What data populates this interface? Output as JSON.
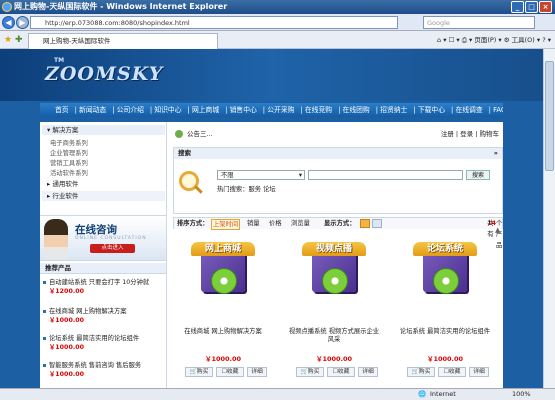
{
  "window": {
    "title": "网上购物-天纵国际软件 - Windows Internet Explorer",
    "min": "_",
    "max": "□",
    "close": "×"
  },
  "addressbar": {
    "url": "http://erp.073088.com:8080/shopindex.html",
    "search_placeholder": "Google",
    "back": "◀",
    "forward": "▶"
  },
  "tab": {
    "label": "网上购物-天纵国际软件",
    "toolbar_text": "⌂ ▾ ☐ ▾ ⎙ ▾  页面(P) ▾  ⚙ 工具(O) ▾  ? ▾"
  },
  "status": {
    "zone": "Internet",
    "zoom": "100%"
  },
  "site": {
    "logo_tm": "TM",
    "logo": "ZOOMSKY",
    "nav": [
      "首页",
      "新闻动态",
      "公司介绍",
      "知识中心",
      "网上商城",
      "销售中心",
      "公开采购",
      "在线竞购",
      "在线团购",
      "招贤纳士",
      "下载中心",
      "在线调查",
      "FAQ",
      "论坛"
    ]
  },
  "left": {
    "cat1": "解决方案",
    "subs": [
      "电子商务系列",
      "企业管理系列",
      "营销工具系列",
      "活动软件系列"
    ],
    "cat2": "通用软件",
    "cat3": "行业软件",
    "consult_title": "在线咨询",
    "consult_en": "ONLINE CONSULTATION",
    "consult_btn": "点击进入",
    "rec_title": "推荐产品",
    "rec": [
      {
        "name": "自动建站系统 只要会打字 10分钟就",
        "price": "￥1200.00"
      },
      {
        "name": "在线商城 网上购物解决方案",
        "price": "￥1000.00"
      },
      {
        "name": "论坛系统 最简洁实用的论坛组件",
        "price": "￥1000.00"
      },
      {
        "name": "智能服务系统 售前咨询 售后服务",
        "price": "￥1000.00"
      }
    ]
  },
  "right": {
    "notice": "公告三...",
    "links": "注册 | 登录 | 购物车",
    "search_head": "搜索",
    "select_value": "不限",
    "search_btn": "搜索",
    "hot": "热门搜索：服务 论坛",
    "sort_label": "排序方式：",
    "sort_opts": [
      "上架时间",
      "销量",
      "价格",
      "浏览量"
    ],
    "display_label": "显示方式：",
    "total_pre": "共有",
    "total_num": "14",
    "total_post": "个产品",
    "products": [
      {
        "banner": "网上商城",
        "name": "在线商城 网上购物解决方案",
        "price": "￥1000.00"
      },
      {
        "banner": "视频点播",
        "name": "视频点播系统 视频方式展示企业风采",
        "price": "￥1000.00"
      },
      {
        "banner": "论坛系统",
        "name": "论坛系统 最简洁实用的论坛组件",
        "price": "￥1000.00"
      }
    ],
    "btn_buy": "购买",
    "btn_fav": "收藏",
    "btn_detail": "详细"
  }
}
